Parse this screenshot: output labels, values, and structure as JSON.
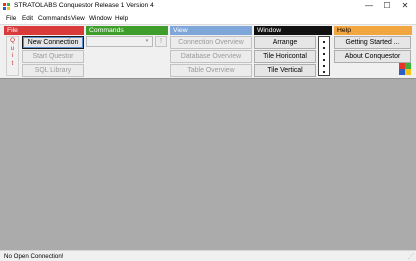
{
  "window": {
    "title": "STRATOLABS Conquestor Release 1 Version 4",
    "minimize_glyph": "—",
    "maximize_glyph": "☐",
    "close_glyph": "✕",
    "app_icon": "stratolabs-logo-icon"
  },
  "menubar": {
    "items": [
      "File",
      "Edit",
      "Commands",
      "View",
      "Window",
      "Help"
    ]
  },
  "toolbar": {
    "file": {
      "header": "File",
      "color": "#d93a3a",
      "quit_letters": [
        "Q",
        "u",
        "i",
        "t"
      ],
      "buttons": [
        "New Connection",
        "Start Questor",
        "SQL Library"
      ]
    },
    "commands": {
      "header": "Commands",
      "color": "#3f9e2b",
      "combo_value": "",
      "combo_arrow": "▾",
      "exec_label": "!"
    },
    "view": {
      "header": "View",
      "color": "#7fa6d9",
      "buttons": [
        "Connection Overview",
        "Database Overview",
        "Table Overview"
      ]
    },
    "window": {
      "header": "Window",
      "color": "#111111",
      "buttons": [
        "Arrange",
        "Tile Horicontal",
        "Tile Vertical"
      ]
    },
    "help": {
      "header": "Help",
      "color": "#f2a640",
      "buttons": [
        "Getting Started ...",
        "About Conquestor"
      ]
    }
  },
  "statusbar": {
    "text": "No Open Connection!",
    "grip": "⋰"
  },
  "colors": {
    "workspace": "#ababab",
    "logo_red": "#e8332a",
    "logo_green": "#3fae3a",
    "logo_blue": "#2a5fc4",
    "logo_yellow": "#f5c316"
  }
}
